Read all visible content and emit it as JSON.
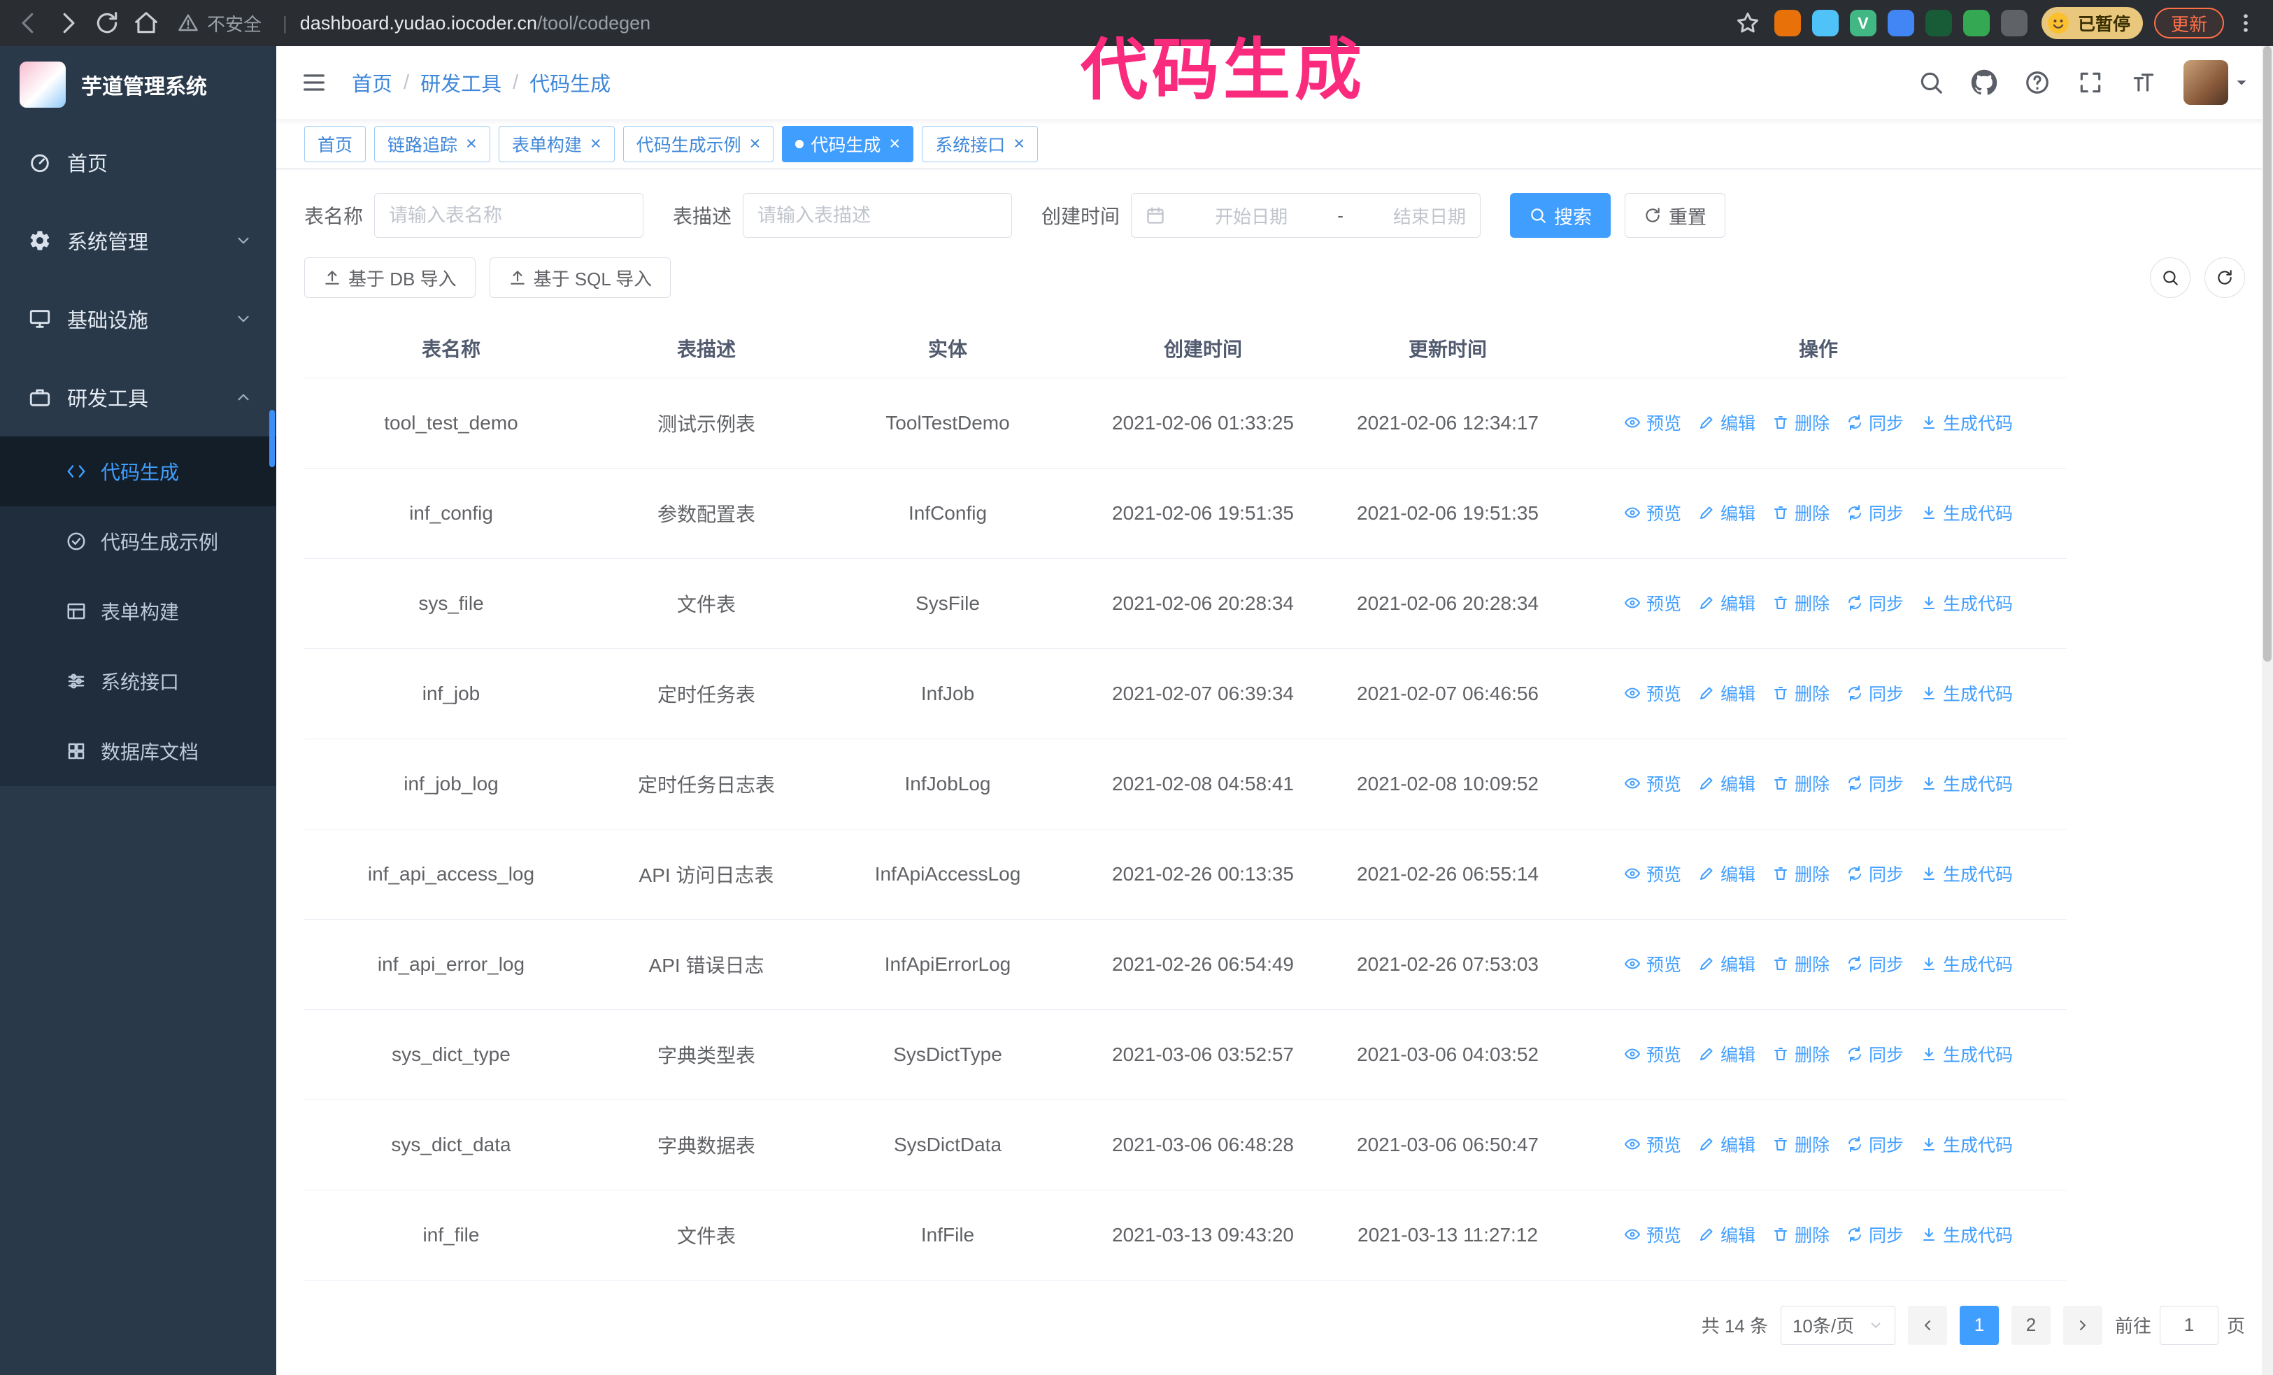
{
  "colors": {
    "accent": "#409eff",
    "annotation": "#fa2a7d",
    "chrome-bg": "#2a2d31",
    "sidebar-bg": "#293949",
    "submenu-bg": "#1f2d3d",
    "menu-active-bg": "#141e28",
    "link-blue": "#3f87d8",
    "update-orange": "#ff7049"
  },
  "browser": {
    "security_label": "不安全",
    "url_divider": "|",
    "url_domain": "dashboard.yudao.iocoder.cn",
    "url_path": "/tool/codegen",
    "extensions": [
      {
        "name": "extension-icon-orange",
        "color": "#e8710a",
        "glyph": ""
      },
      {
        "name": "extension-icon-lightblue",
        "color": "#4fc3f7",
        "glyph": ""
      },
      {
        "name": "extension-icon-vue",
        "color": "#41b883",
        "glyph": "V"
      },
      {
        "name": "extension-icon-blue",
        "color": "#4285f4",
        "glyph": ""
      },
      {
        "name": "extension-icon-darkgreen",
        "color": "#185c37",
        "glyph": ""
      },
      {
        "name": "extension-icon-green",
        "color": "#34a853",
        "glyph": ""
      },
      {
        "name": "extension-icon-gray",
        "color": "#5f6368",
        "glyph": ""
      }
    ],
    "profile_badge": "已暂停",
    "update_label": "更新"
  },
  "annotation": {
    "text": "代码生成"
  },
  "sidebar": {
    "logo_title": "芋道管理系统",
    "menu": [
      {
        "name": "sidebar-item-home",
        "label": "首页",
        "icon": "dashboard-icon"
      },
      {
        "name": "sidebar-item-system",
        "label": "系统管理",
        "icon": "gear-icon",
        "chevron": "down"
      },
      {
        "name": "sidebar-item-infra",
        "label": "基础设施",
        "icon": "infra-icon",
        "chevron": "down"
      },
      {
        "name": "sidebar-item-devtools",
        "label": "研发工具",
        "icon": "tools-icon",
        "chevron": "up",
        "children": [
          {
            "name": "sidebar-item-codegen",
            "label": "代码生成",
            "icon": "code-icon",
            "active": true
          },
          {
            "name": "sidebar-item-codegen-example",
            "label": "代码生成示例",
            "icon": "example-icon"
          },
          {
            "name": "sidebar-item-form-builder",
            "label": "表单构建",
            "icon": "form-icon"
          },
          {
            "name": "sidebar-item-api",
            "label": "系统接口",
            "icon": "api-icon"
          },
          {
            "name": "sidebar-item-db-doc",
            "label": "数据库文档",
            "icon": "dbdoc-icon"
          }
        ]
      }
    ]
  },
  "navbar": {
    "breadcrumb": [
      "首页",
      "研发工具",
      "代码生成"
    ],
    "breadcrumb_separator": "/"
  },
  "tabs": [
    {
      "name": "tab-home",
      "label": "首页",
      "closable": false,
      "active": false
    },
    {
      "name": "tab-tracing",
      "label": "链路追踪",
      "closable": true,
      "active": false
    },
    {
      "name": "tab-form-builder",
      "label": "表单构建",
      "closable": true,
      "active": false
    },
    {
      "name": "tab-codegen-example",
      "label": "代码生成示例",
      "closable": true,
      "active": false
    },
    {
      "name": "tab-codegen",
      "label": "代码生成",
      "closable": true,
      "active": true
    },
    {
      "name": "tab-api",
      "label": "系统接口",
      "closable": true,
      "active": false
    }
  ],
  "filters": {
    "table_name_label": "表名称",
    "table_name_placeholder": "请输入表名称",
    "table_desc_label": "表描述",
    "table_desc_placeholder": "请输入表描述",
    "create_time_label": "创建时间",
    "start_date_placeholder": "开始日期",
    "range_separator": "-",
    "end_date_placeholder": "结束日期",
    "search_label": "搜索",
    "reset_label": "重置"
  },
  "toolbar": {
    "import_db_label": "基于 DB 导入",
    "import_sql_label": "基于 SQL 导入"
  },
  "table": {
    "columns": [
      "表名称",
      "表描述",
      "实体",
      "创建时间",
      "更新时间",
      "操作"
    ],
    "actions": [
      {
        "name": "preview-link",
        "label": "预览",
        "icon": "eye-icon"
      },
      {
        "name": "edit-link",
        "label": "编辑",
        "icon": "edit-icon"
      },
      {
        "name": "delete-link",
        "label": "删除",
        "icon": "delete-icon"
      },
      {
        "name": "sync-link",
        "label": "同步",
        "icon": "sync-icon"
      },
      {
        "name": "generate-code-link",
        "label": "生成代码",
        "icon": "download-icon"
      }
    ],
    "rows": [
      {
        "name": "tool_test_demo",
        "desc": "测试示例表",
        "entity": "ToolTestDemo",
        "created": "2021-02-06 01:33:25",
        "updated": "2021-02-06 12:34:17"
      },
      {
        "name": "inf_config",
        "desc": "参数配置表",
        "entity": "InfConfig",
        "created": "2021-02-06 19:51:35",
        "updated": "2021-02-06 19:51:35"
      },
      {
        "name": "sys_file",
        "desc": "文件表",
        "entity": "SysFile",
        "created": "2021-02-06 20:28:34",
        "updated": "2021-02-06 20:28:34"
      },
      {
        "name": "inf_job",
        "desc": "定时任务表",
        "entity": "InfJob",
        "created": "2021-02-07 06:39:34",
        "updated": "2021-02-07 06:46:56"
      },
      {
        "name": "inf_job_log",
        "desc": "定时任务日志表",
        "entity": "InfJobLog",
        "created": "2021-02-08 04:58:41",
        "updated": "2021-02-08 10:09:52"
      },
      {
        "name": "inf_api_access_log",
        "desc": "API 访问日志表",
        "entity": "InfApiAccessLog",
        "created": "2021-02-26 00:13:35",
        "updated": "2021-02-26 06:55:14"
      },
      {
        "name": "inf_api_error_log",
        "desc": "API 错误日志",
        "entity": "InfApiErrorLog",
        "created": "2021-02-26 06:54:49",
        "updated": "2021-02-26 07:53:03"
      },
      {
        "name": "sys_dict_type",
        "desc": "字典类型表",
        "entity": "SysDictType",
        "created": "2021-03-06 03:52:57",
        "updated": "2021-03-06 04:03:52"
      },
      {
        "name": "sys_dict_data",
        "desc": "字典数据表",
        "entity": "SysDictData",
        "created": "2021-03-06 06:48:28",
        "updated": "2021-03-06 06:50:47"
      },
      {
        "name": "inf_file",
        "desc": "文件表",
        "entity": "InfFile",
        "created": "2021-03-13 09:43:20",
        "updated": "2021-03-13 11:27:12"
      }
    ]
  },
  "pagination": {
    "total_label": "共 14 条",
    "page_size_label": "10条/页",
    "pages": [
      "1",
      "2"
    ],
    "active_page": "1",
    "goto_label": "前往",
    "goto_value": "1",
    "goto_unit": "页"
  }
}
